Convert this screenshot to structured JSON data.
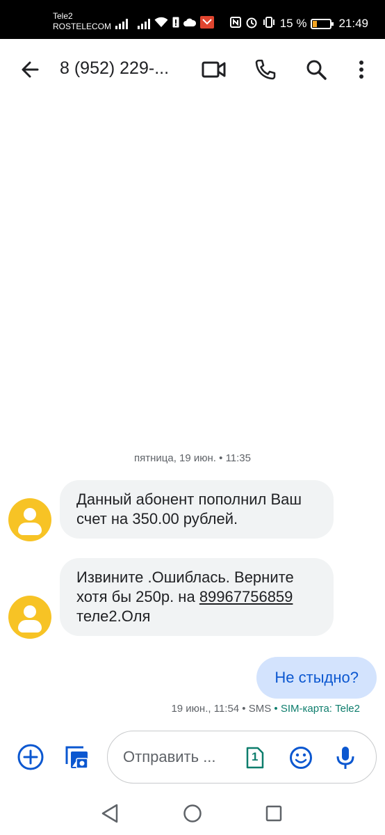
{
  "status_bar": {
    "carrier_line1": "Tele2",
    "carrier_line2": "ROSTELECOM",
    "battery_percent": "15 %",
    "time": "21:49"
  },
  "header": {
    "title": "8 (952) 229-...",
    "icons": [
      "back-arrow-icon",
      "video-call-icon",
      "phone-icon",
      "search-icon",
      "more-vert-icon"
    ]
  },
  "conversation": {
    "date_separator": "пятница, 19 июн. • 11:35",
    "messages": [
      {
        "direction": "incoming",
        "text": "Данный абонент пополнил Ваш счет на 350.00 рублей."
      },
      {
        "direction": "incoming",
        "text_before": "Извините .Ошиблась. Верните хотя бы 250р. на",
        "phone_link": "89967756859",
        "text_after": "теле2.Оля"
      },
      {
        "direction": "outgoing",
        "text": "Не стыдно?"
      }
    ],
    "outgoing_meta": "19 июн., 11:54 • SMS",
    "outgoing_sim": "• SIM-карта: Tele2"
  },
  "compose": {
    "placeholder": "Отправить ...",
    "sim_label": "1"
  },
  "colors": {
    "avatar": "#f7c325",
    "outgoing_bubble": "#d3e3fd",
    "incoming_bubble": "#f1f3f4",
    "accent": "#0b57d0",
    "sim_text": "#0d7d6c"
  }
}
